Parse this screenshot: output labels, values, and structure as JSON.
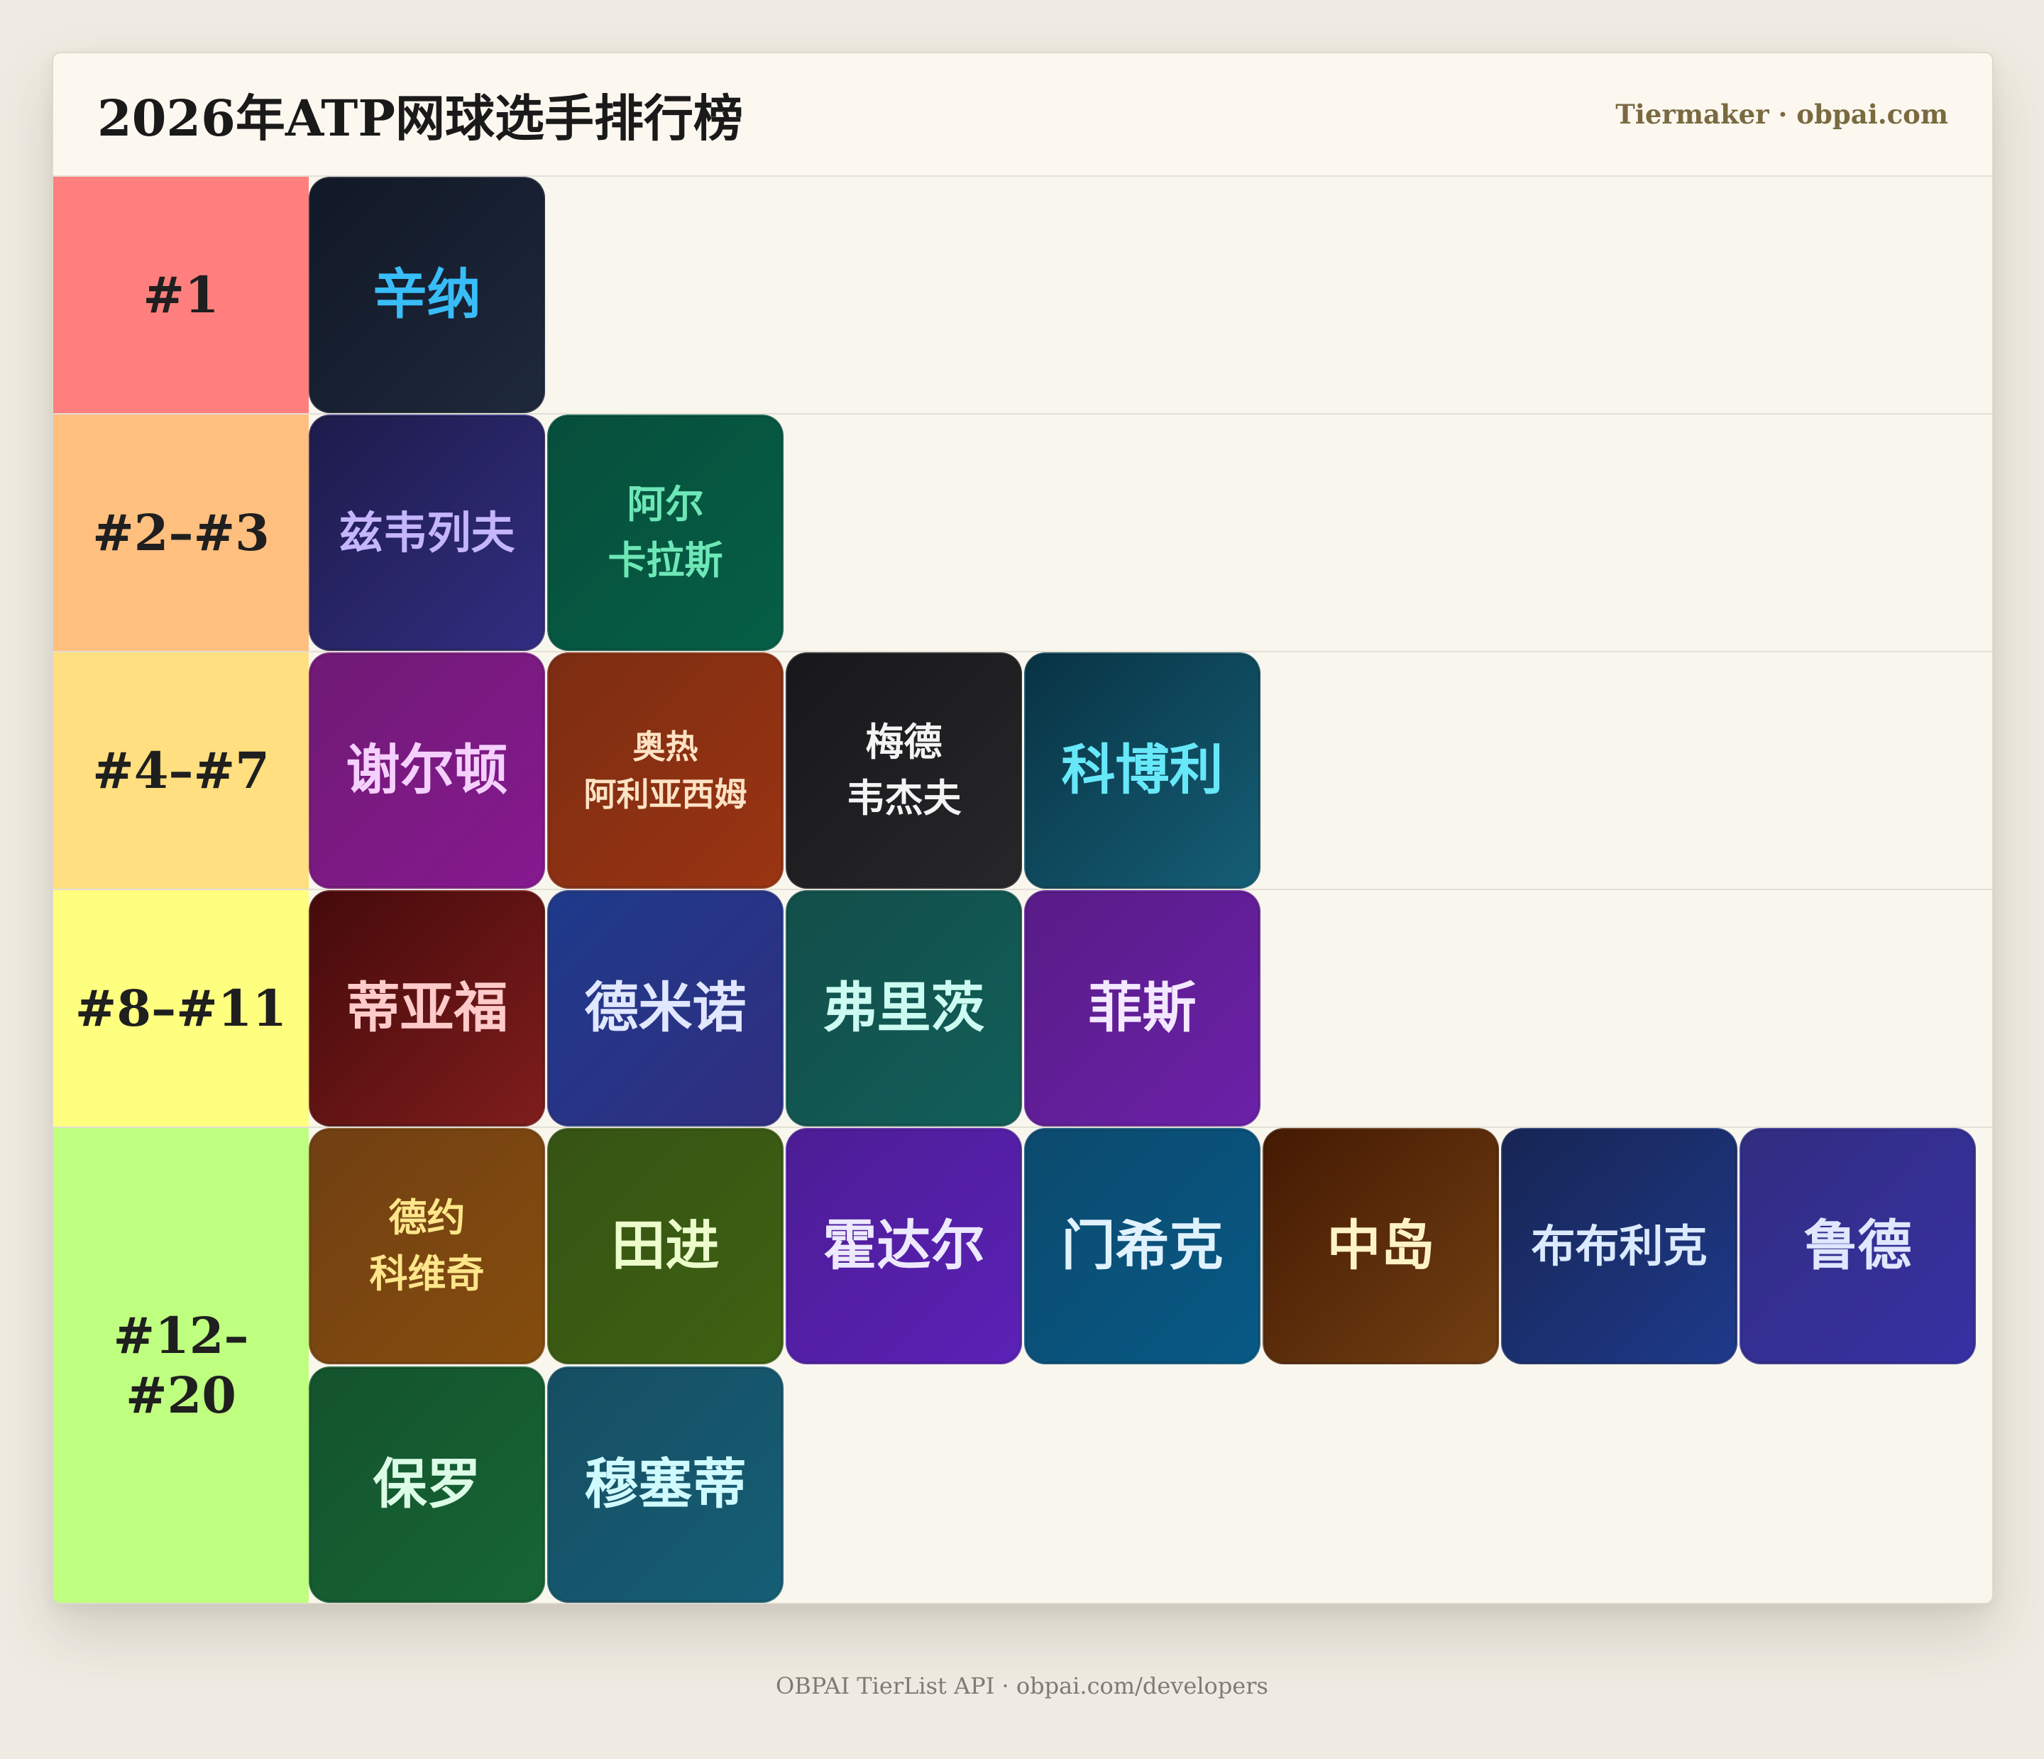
{
  "header": {
    "title": "2026年ATP网球选手排行榜",
    "brand": "Tiermaker · obpai.com"
  },
  "tiers": [
    {
      "label": "#1",
      "color": "#ff7f7e",
      "items": [
        {
          "name": "辛纳",
          "bg1": "#111827",
          "bg2": "#1e293b",
          "fg": "#38bdf8",
          "size": "fs-xl"
        }
      ]
    },
    {
      "label": "#2–#3",
      "color": "#ffbf7f",
      "items": [
        {
          "name": "兹韦列夫",
          "bg1": "#1e1b4b",
          "bg2": "#312e81",
          "fg": "#c4b5fd",
          "size": "fs-m"
        },
        {
          "name": "阿尔\n卡拉斯",
          "bg1": "#064e3b",
          "bg2": "#065f46",
          "fg": "#6ee7b7",
          "size": "fs-s"
        }
      ]
    },
    {
      "label": "#4–#7",
      "color": "#ffdf7f",
      "items": [
        {
          "name": "谢尔顿",
          "bg1": "#701a75",
          "bg2": "#86198f",
          "fg": "#f5d0fe",
          "size": "fs-xl"
        },
        {
          "name": "奥热\n阿利亚西姆",
          "bg1": "#7c2d12",
          "bg2": "#9a3412",
          "fg": "#fde2c4",
          "size": "fs-xs"
        },
        {
          "name": "梅德\n韦杰夫",
          "bg1": "#18181b",
          "bg2": "#27272a",
          "fg": "#f4f4f5",
          "size": "fs-s"
        },
        {
          "name": "科博利",
          "bg1": "#083344",
          "bg2": "#155e75",
          "fg": "#67e8f9",
          "size": "fs-xl"
        }
      ]
    },
    {
      "label": "#8–#11",
      "color": "#ffff7f",
      "items": [
        {
          "name": "蒂亚福",
          "bg1": "#450a0a",
          "bg2": "#7f1d1d",
          "fg": "#fecaca",
          "size": "fs-xl"
        },
        {
          "name": "德米诺",
          "bg1": "#1e3a8a",
          "bg2": "#312e81",
          "fg": "#e0e7ff",
          "size": "fs-xl"
        },
        {
          "name": "弗里茨",
          "bg1": "#134e4a",
          "bg2": "#115e59",
          "fg": "#ccfbf1",
          "size": "fs-xl"
        },
        {
          "name": "菲斯",
          "bg1": "#581c87",
          "bg2": "#6b21a8",
          "fg": "#f3e8ff",
          "size": "fs-xl"
        }
      ]
    },
    {
      "label": "#12–\n#20",
      "color": "#bfff7f",
      "items": [
        {
          "name": "德约\n科维奇",
          "bg1": "#713f12",
          "bg2": "#854d0e",
          "fg": "#fde68a",
          "size": "fs-s"
        },
        {
          "name": "田进",
          "bg1": "#365314",
          "bg2": "#3f6212",
          "fg": "#ecfccb",
          "size": "fs-xl"
        },
        {
          "name": "霍达尔",
          "bg1": "#4c1d95",
          "bg2": "#5b21b6",
          "fg": "#ede9fe",
          "size": "fs-xl"
        },
        {
          "name": "门希克",
          "bg1": "#0c4a6e",
          "bg2": "#075985",
          "fg": "#e0f2fe",
          "size": "fs-xl"
        },
        {
          "name": "中岛",
          "bg1": "#451a03",
          "bg2": "#713f12",
          "fg": "#fef3c7",
          "size": "fs-xl"
        },
        {
          "name": "布布利克",
          "bg1": "#172554",
          "bg2": "#1e3a8a",
          "fg": "#dbeafe",
          "size": "fs-m"
        },
        {
          "name": "鲁德",
          "bg1": "#312e81",
          "bg2": "#3730a3",
          "fg": "#e0e7ff",
          "size": "fs-xl"
        },
        {
          "name": "保罗",
          "bg1": "#14532d",
          "bg2": "#166534",
          "fg": "#dcfce7",
          "size": "fs-xl"
        },
        {
          "name": "穆塞蒂",
          "bg1": "#164e63",
          "bg2": "#155e75",
          "fg": "#cffafe",
          "size": "fs-xl"
        }
      ]
    }
  ],
  "footer": {
    "text": "OBPAI TierList API · obpai.com/developers"
  }
}
